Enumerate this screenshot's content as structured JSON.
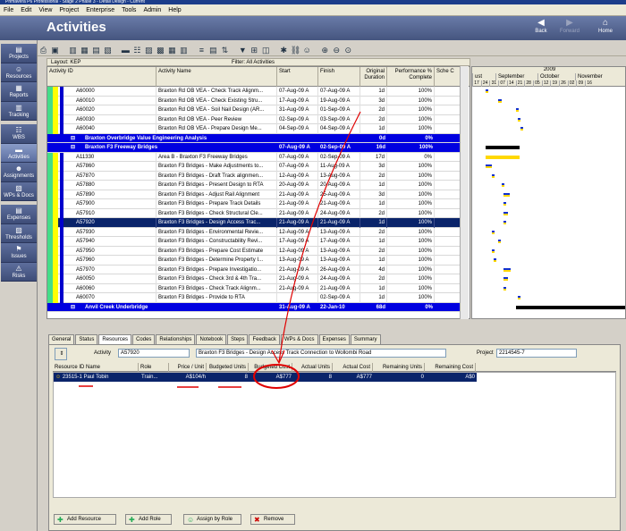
{
  "window": {
    "title": "Primavera P6 Professional - Stage 2 Phase 3 - Detail Design - Current"
  },
  "menu": [
    "File",
    "Edit",
    "View",
    "Project",
    "Enterprise",
    "Tools",
    "Admin",
    "Help"
  ],
  "header": {
    "title": "Activities",
    "back": "Back",
    "forward": "Forward",
    "home": "Home"
  },
  "sidebar": [
    "Projects",
    "Resources",
    "Reports",
    "Tracking",
    "WBS",
    "Activities",
    "Assignments",
    "WPs & Docs",
    "Expenses",
    "Thresholds",
    "Issues",
    "Risks"
  ],
  "layout": {
    "label": "Layout: KEP",
    "filter": "Filter: All Activities"
  },
  "grid": {
    "columns": [
      "Activity ID",
      "Activity Name",
      "Start",
      "Finish",
      "Original Duration",
      "Performance % Complete",
      "Sche C"
    ],
    "rows": [
      {
        "id": "A60000",
        "name": "Braxton Rd OB VEA - Check Track Alignm...",
        "start": "07-Aug-09 A",
        "finish": "07-Aug-09 A",
        "dur": "1d",
        "pct": "100%"
      },
      {
        "id": "A60010",
        "name": "Braxton Rd OB VEA - Check Existing Stru...",
        "start": "17-Aug-09 A",
        "finish": "19-Aug-09 A",
        "dur": "3d",
        "pct": "100%"
      },
      {
        "id": "A60020",
        "name": "Braxton Rd OB VEA - Soil Nail Design (AR...",
        "start": "31-Aug-09 A",
        "finish": "01-Sep-09 A",
        "dur": "2d",
        "pct": "100%"
      },
      {
        "id": "A60030",
        "name": "Braxton Rd OB VEA - Peer Review",
        "start": "02-Sep-09 A",
        "finish": "03-Sep-09 A",
        "dur": "2d",
        "pct": "100%"
      },
      {
        "id": "A60040",
        "name": "Braxton Rd OB VEA - Prepare Design Me...",
        "start": "04-Sep-09 A",
        "finish": "04-Sep-09 A",
        "dur": "1d",
        "pct": "100%"
      },
      {
        "group": true,
        "name": "Braxton Overbridge Value Engineering Analysis",
        "start": "",
        "finish": "",
        "dur": "0d",
        "pct": "0%"
      },
      {
        "group": true,
        "name": "Braxton F3 Freeway Bridges",
        "start": "07-Aug-09 A",
        "finish": "02-Sep-09 A",
        "dur": "16d",
        "pct": "100%"
      },
      {
        "id": "A11330",
        "name": "Area B - Braxton F3 Freeway Bridges",
        "start": "07-Aug-09 A",
        "finish": "02-Sep-09 A",
        "dur": "17d",
        "pct": "0%"
      },
      {
        "id": "A57860",
        "name": "Braxton F3 Bridges - Make Adjustments to...",
        "start": "07-Aug-09 A",
        "finish": "11-Aug-09 A",
        "dur": "3d",
        "pct": "100%"
      },
      {
        "id": "A57870",
        "name": "Braxton F3 Bridges - Draft Track alignmen...",
        "start": "12-Aug-09 A",
        "finish": "13-Aug-09 A",
        "dur": "2d",
        "pct": "100%"
      },
      {
        "id": "A57880",
        "name": "Braxton F3 Bridges - Present Design to RTA",
        "start": "20-Aug-09 A",
        "finish": "20-Aug-09 A",
        "dur": "1d",
        "pct": "100%"
      },
      {
        "id": "A57890",
        "name": "Braxton F3 Bridges - Adjust Rail Alignment",
        "start": "21-Aug-09 A",
        "finish": "25-Aug-09 A",
        "dur": "3d",
        "pct": "100%"
      },
      {
        "id": "A57900",
        "name": "Braxton F3 Bridges - Prepare Track Details",
        "start": "21-Aug-09 A",
        "finish": "21-Aug-09 A",
        "dur": "1d",
        "pct": "100%"
      },
      {
        "id": "A57910",
        "name": "Braxton F3 Bridges - Check Structural Cle...",
        "start": "21-Aug-09 A",
        "finish": "24-Aug-09 A",
        "dur": "2d",
        "pct": "100%"
      },
      {
        "id": "A57920",
        "name": "Braxton F3 Bridges - Design Access Trac...",
        "start": "21-Aug-09 A",
        "finish": "21-Aug-09 A",
        "dur": "1d",
        "pct": "100%",
        "selected": true
      },
      {
        "id": "A57930",
        "name": "Braxton F3 Bridges - Environmental Revie...",
        "start": "12-Aug-09 A",
        "finish": "13-Aug-09 A",
        "dur": "2d",
        "pct": "100%"
      },
      {
        "id": "A57940",
        "name": "Braxton F3 Bridges - Constructability Revi...",
        "start": "17-Aug-09 A",
        "finish": "17-Aug-09 A",
        "dur": "1d",
        "pct": "100%"
      },
      {
        "id": "A57950",
        "name": "Braxton F3 Bridges - Prepare Cost Estimate",
        "start": "12-Aug-09 A",
        "finish": "13-Aug-09 A",
        "dur": "2d",
        "pct": "100%"
      },
      {
        "id": "A57960",
        "name": "Braxton F3 Bridges - Determine Property I...",
        "start": "13-Aug-09 A",
        "finish": "13-Aug-09 A",
        "dur": "1d",
        "pct": "100%"
      },
      {
        "id": "A57970",
        "name": "Braxton F3 Bridges - Prepare Investigatio...",
        "start": "21-Aug-09 A",
        "finish": "26-Aug-09 A",
        "dur": "4d",
        "pct": "100%"
      },
      {
        "id": "A60050",
        "name": "Braxton F3 Bridges - Check 3rd & 4th Tra...",
        "start": "21-Aug-09 A",
        "finish": "24-Aug-09 A",
        "dur": "2d",
        "pct": "100%"
      },
      {
        "id": "A60060",
        "name": "Braxton F3 Bridges - Check Track Alignm...",
        "start": "21-Aug-09 A",
        "finish": "21-Aug-09 A",
        "dur": "1d",
        "pct": "100%"
      },
      {
        "id": "A60070",
        "name": "Braxton F3 Bridges - Provide to RTA",
        "start": "",
        "finish": "02-Sep-09 A",
        "dur": "1d",
        "pct": "100%"
      },
      {
        "group": true,
        "name": "Anvil Creek Underbridge",
        "start": "31-Aug-09 A",
        "finish": "22-Jan-10",
        "dur": "68d",
        "pct": "0%"
      }
    ]
  },
  "gantt": {
    "year": "2009",
    "months": [
      "ust",
      "September",
      "October",
      "November"
    ],
    "days": [
      "17",
      "24",
      "31",
      "07",
      "14",
      "21",
      "28",
      "05",
      "12",
      "19",
      "26",
      "02",
      "09",
      "16"
    ]
  },
  "tabs": [
    "General",
    "Status",
    "Resources",
    "Codes",
    "Relationships",
    "Notebook",
    "Steps",
    "Feedback",
    "WPs & Docs",
    "Expenses",
    "Summary"
  ],
  "detail": {
    "activity_label": "Activity",
    "activity_id": "A57920",
    "activity_name": "Braxton F3 Bridges - Design Access Track Connection to Wollombi Road",
    "project_label": "Project",
    "project_id": "2214545-7",
    "columns": [
      "Resource ID Name",
      "Role",
      "Price / Unit",
      "Budgeted Units",
      "Budgeted Cost",
      "Actual Units",
      "Actual Cost",
      "Remaining Units",
      "Remaining Cost"
    ],
    "resource": {
      "name": "23515-1 Paul Tobin",
      "role": "Train...",
      "price": "A$104/h",
      "bunits": "8",
      "bcost": "A$777",
      "aunits": "8",
      "acost": "A$777",
      "runits": "0",
      "rcost": "A$0"
    },
    "buttons": [
      "Add Resource",
      "Add Role",
      "Assign by Role",
      "Remove"
    ]
  },
  "colors": {
    "header": "#4e5f8c",
    "group_row": "#0000e0",
    "selected_row": "#0a246a",
    "annotation": "#e00000"
  }
}
